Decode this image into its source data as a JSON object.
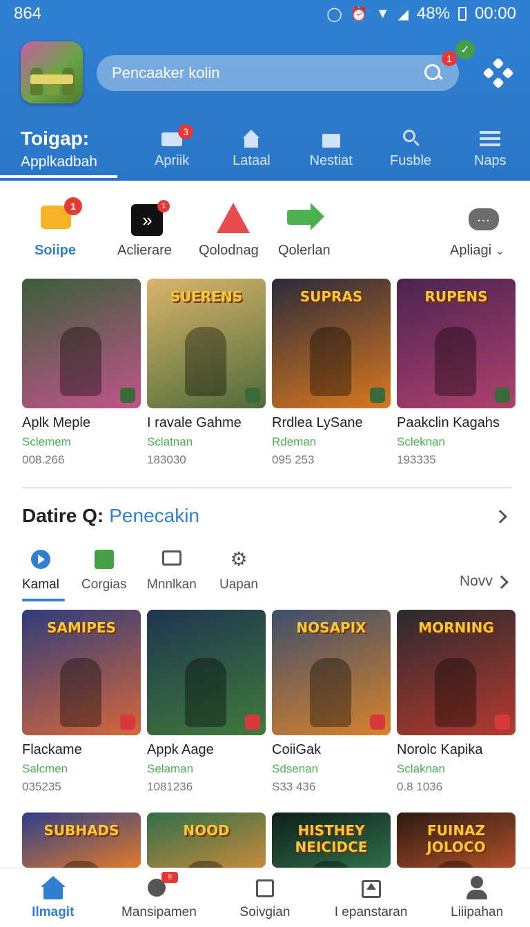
{
  "status": {
    "time_left": "864",
    "battery": "48%",
    "clock": "00:00"
  },
  "header": {
    "search_placeholder": "Pencaaker kolin",
    "notif_count": "1",
    "tabs": [
      {
        "label_top": "Toigap:",
        "label": "Applkadbah"
      },
      {
        "label": "Apriik",
        "badge": "3"
      },
      {
        "label": "Lataal"
      },
      {
        "label": "Nestiat"
      },
      {
        "label": "Fusble"
      },
      {
        "label": "Naps"
      }
    ]
  },
  "categories": [
    {
      "label": "Soiipe",
      "badge": "1"
    },
    {
      "label": "Aclierare",
      "badge": "1"
    },
    {
      "label": "Qolodnag"
    },
    {
      "label": "Qolerlan"
    },
    {
      "label": "Apliagi"
    }
  ],
  "row1": [
    {
      "title_art": "",
      "name": "Aplk Meple",
      "sub": "Sclemem",
      "num": "008.266",
      "c1": "#3a5f3a",
      "c2": "#c2548b"
    },
    {
      "title_art": "SUERENS",
      "name": "I ravale Gahme",
      "sub": "Sclatnan",
      "num": "183030",
      "c1": "#d9b56b",
      "c2": "#4f6b3a"
    },
    {
      "title_art": "SUPRAS",
      "name": "Rrdlea LySane",
      "sub": "Rdeman",
      "num": "095 253",
      "c1": "#2b2b3a",
      "c2": "#d9781f"
    },
    {
      "title_art": "RUPENS",
      "name": "Paakclin Kagahs",
      "sub": "Scleknan",
      "num": "193335",
      "c1": "#4a2450",
      "c2": "#b0406e"
    }
  ],
  "section": {
    "title": "Datire Q:",
    "link": "Penecakin"
  },
  "subtabs": [
    {
      "label": "Kamal"
    },
    {
      "label": "Corgias"
    },
    {
      "label": "Mnnlkan"
    },
    {
      "label": "Uapan"
    }
  ],
  "more_label": "Novv",
  "row2": [
    {
      "title_art": "SAMIPES",
      "name": "Flackame",
      "sub": "Salcmen",
      "num": "035235",
      "c1": "#2e3d7a",
      "c2": "#d6673a"
    },
    {
      "title_art": "",
      "name": "Appk Aage",
      "sub": "Selaman",
      "num": "1081236",
      "c1": "#1f3550",
      "c2": "#3f7a3a"
    },
    {
      "title_art": "NOSAPIX",
      "name": "CoiiGak",
      "sub": "Sdsenan",
      "num": "S33 436",
      "c1": "#3d4f6b",
      "c2": "#d9822a"
    },
    {
      "title_art": "MORNING",
      "name": "Norolc Kapika",
      "sub": "Sclaknan",
      "num": "0.8 1036",
      "c1": "#2a2a2e",
      "c2": "#b43a2e"
    }
  ],
  "row3": [
    {
      "title_art": "SUBHADS",
      "c1": "#2c3f8a",
      "c2": "#e07a2a"
    },
    {
      "title_art": "NOOD",
      "c1": "#2f6f4a",
      "c2": "#c78a3a"
    },
    {
      "title_art": "HISTHEY NEICIDCE",
      "c1": "#0f1f1a",
      "c2": "#2f6f4a"
    },
    {
      "title_art": "FUINAZ JOLOCO",
      "c1": "#2b1a12",
      "c2": "#b0502a"
    }
  ],
  "bottom_nav": [
    {
      "label": "Ilmagit"
    },
    {
      "label": "Mansipamen",
      "badge": "!!"
    },
    {
      "label": "Soivgian"
    },
    {
      "label": "I epanstaran"
    },
    {
      "label": "Liiipahan"
    }
  ],
  "colors": {
    "primary": "#2f7fd2",
    "green": "#4caf50",
    "badge_red": "#e53935"
  }
}
